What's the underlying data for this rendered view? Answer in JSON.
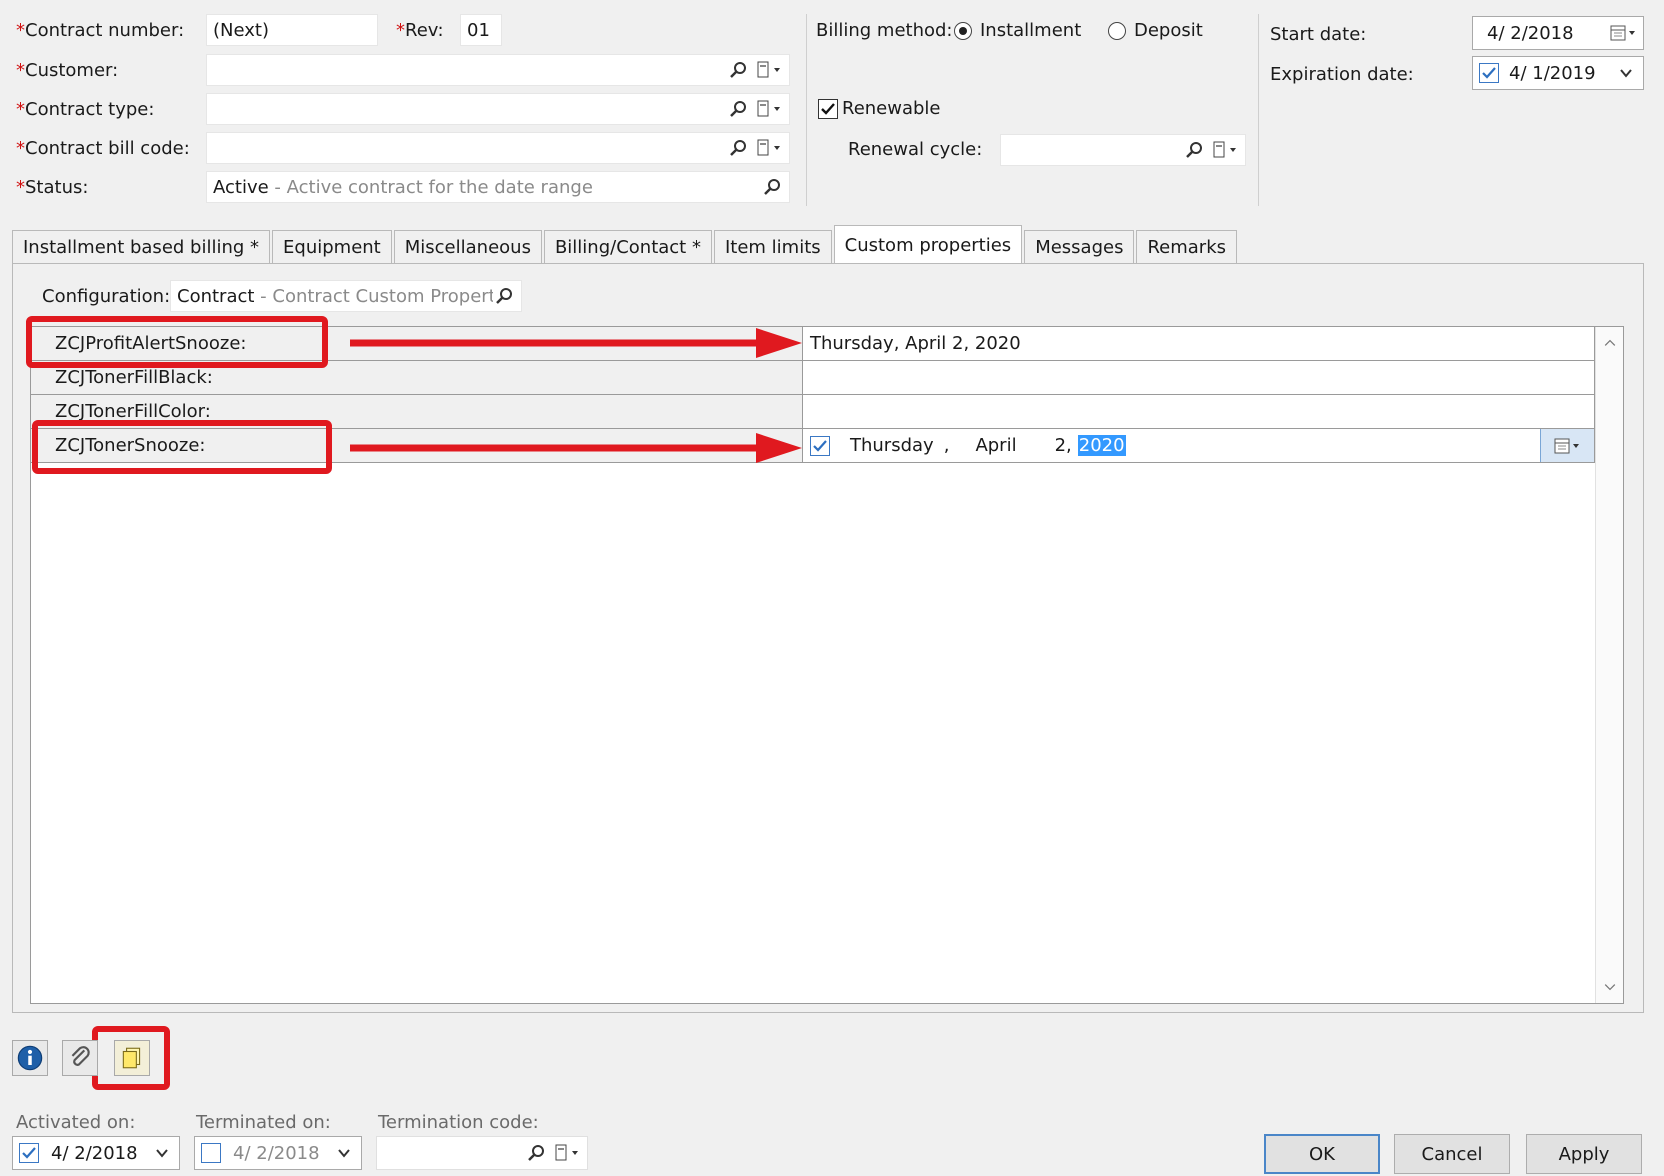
{
  "header": {
    "contract_number_label": "Contract number:",
    "contract_number_value": "(Next)",
    "rev_label": "Rev:",
    "rev_value": "01",
    "customer_label": "Customer:",
    "contract_type_label": "Contract type:",
    "contract_bill_code_label": "Contract bill code:",
    "status_label": "Status:",
    "status_value": "Active",
    "status_desc": " - Active contract for the date range",
    "billing_method_label": "Billing method:",
    "billing_installment": "Installment",
    "billing_deposit": "Deposit",
    "renewable_label": "Renewable",
    "renewal_cycle_label": "Renewal cycle:",
    "start_date_label": "Start date:",
    "start_date_value": "4/ 2/2018",
    "expiration_date_label": "Expiration date:",
    "expiration_date_value": "4/ 1/2019"
  },
  "tabs": [
    {
      "label": "Installment based billing *"
    },
    {
      "label": "Equipment"
    },
    {
      "label": "Miscellaneous"
    },
    {
      "label": "Billing/Contact *"
    },
    {
      "label": "Item limits"
    },
    {
      "label": "Custom properties"
    },
    {
      "label": "Messages"
    },
    {
      "label": "Remarks"
    }
  ],
  "custom": {
    "configuration_label": "Configuration:",
    "configuration_value": "Contract",
    "configuration_desc": " - Contract Custom Properties",
    "rows": [
      {
        "name": "ZCJProfitAlertSnooze:",
        "value": "Thursday, April 2, 2020"
      },
      {
        "name": "ZCJTonerFillBlack:",
        "value": ""
      },
      {
        "name": "ZCJTonerFillColor:",
        "value": ""
      },
      {
        "name": "ZCJTonerSnooze:",
        "value": ""
      }
    ],
    "editor": {
      "weekday": "Thursday",
      "comma1": ",",
      "month": "April",
      "day": "2,",
      "year": "2020"
    }
  },
  "footer": {
    "activated_on_label": "Activated on:",
    "activated_on_value": "4/ 2/2018",
    "terminated_on_label": "Terminated on:",
    "terminated_on_value": "4/ 2/2018",
    "termination_code_label": "Termination code:",
    "ok_label": "OK",
    "cancel_label": "Cancel",
    "apply_label": "Apply"
  },
  "colors": {
    "annotation_red": "#e0191f",
    "selection_blue": "#3399ff",
    "required_red": "#d01010"
  }
}
